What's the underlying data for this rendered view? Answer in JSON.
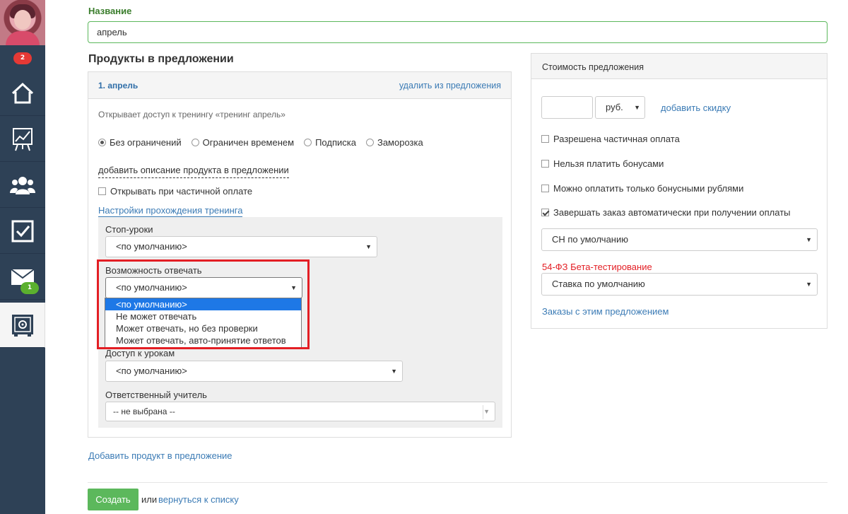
{
  "sidebar": {
    "notifications_badge": "2",
    "messages_badge": "1",
    "items": [
      {
        "icon": "home-icon"
      },
      {
        "icon": "chart-icon"
      },
      {
        "icon": "users-icon"
      },
      {
        "icon": "checkbox-icon"
      },
      {
        "icon": "mail-icon"
      },
      {
        "icon": "safe-icon"
      }
    ]
  },
  "form": {
    "name_label": "Название",
    "name_value": "апрель",
    "products_heading": "Продукты в предложении",
    "add_product_link": "Добавить продукт в предложение",
    "create_button": "Создать",
    "or_text": "или",
    "back_link": "вернуться к списку"
  },
  "product": {
    "number_title": "1. апрель",
    "remove_link": "удалить из предложения",
    "access_text": "Открывает доступ к тренингу «тренинг апрель»",
    "radios": [
      {
        "label": "Без ограничений",
        "checked": true
      },
      {
        "label": "Ограничен временем",
        "checked": false
      },
      {
        "label": "Подписка",
        "checked": false
      },
      {
        "label": "Заморозка",
        "checked": false
      }
    ],
    "add_description_link": "добавить описание продукта в предложении",
    "partial_payment_checkbox": "Открывать при частичной оплате",
    "settings_link": "Настройки прохождения тренинга",
    "stop_lessons_label": "Стоп-уроки",
    "stop_lessons_value": "<по умолчанию>",
    "answer_label": "Возможность отвечать",
    "answer_value": "<по умолчанию>",
    "answer_options": [
      "<по умолчанию>",
      "Не может отвечать",
      "Может отвечать, но без проверки",
      "Может отвечать, авто-принятие ответов"
    ],
    "lessons_access_label": "Доступ к урокам",
    "lessons_access_value": "<по умолчанию>",
    "teacher_label": "Ответственный учитель",
    "teacher_value": "-- не выбрана --"
  },
  "pricing": {
    "title": "Стоимость предложения",
    "price_value": "",
    "currency": "руб.",
    "discount_link": "добавить скидку",
    "checkboxes": [
      {
        "label": "Разрешена частичная оплата",
        "checked": false
      },
      {
        "label": "Нельзя платить бонусами",
        "checked": false
      },
      {
        "label": "Можно оплатить только бонусными рублями",
        "checked": false
      },
      {
        "label": "Завершать заказ автоматически при получении оплаты",
        "checked": true
      }
    ],
    "tax_system_value": "СН по умолчанию",
    "fz_label": "54-ФЗ Бета-тестирование",
    "vat_rate_value": "Ставка по умолчанию",
    "orders_link": "Заказы с этим предложением"
  },
  "colors": {
    "sidebar": "#2e4156",
    "accent_green": "#5cb85c",
    "link_blue": "#3b7bb5",
    "highlight_red": "#e31e24",
    "selected_blue": "#1e78e6"
  }
}
